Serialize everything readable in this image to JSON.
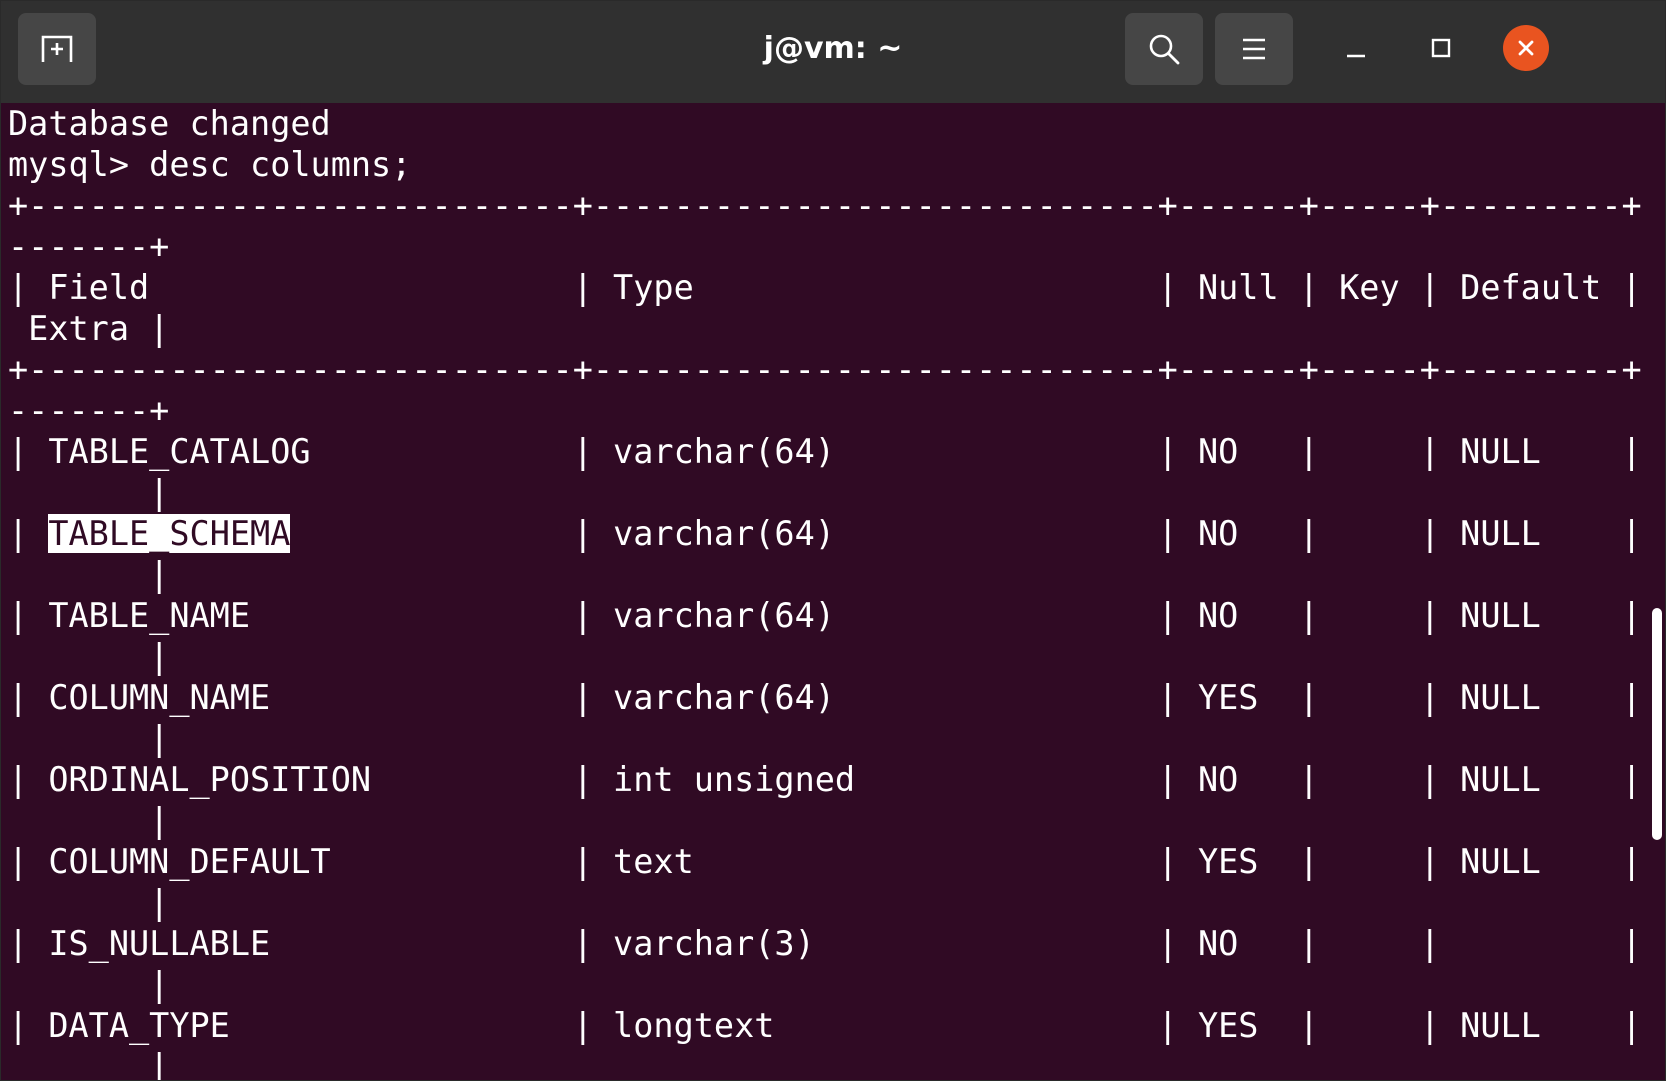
{
  "window": {
    "title": "j@vm: ~"
  },
  "titlebar": {
    "new_tab_icon": "new-tab-icon",
    "search_icon": "search-icon",
    "menu_icon": "hamburger-menu-icon",
    "minimize_icon": "minimize-icon",
    "maximize_icon": "maximize-icon",
    "close_icon": "close-icon"
  },
  "colors": {
    "titlebar_bg": "#303030",
    "terminal_bg": "#300a24",
    "close_button": "#e95420",
    "text": "#ffffff"
  },
  "terminal": {
    "lines": [
      "Database changed",
      "mysql> desc columns;",
      "+---------------------------+----------------------------+------+-----+---------+",
      "-------+",
      "| Field                     | Type                       | Null | Key | Default |",
      " Extra |",
      "+---------------------------+----------------------------+------+-----+---------+",
      "-------+",
      "| TABLE_CATALOG             | varchar(64)                | NO   |     | NULL    |",
      "       |",
      "| ",
      "       |",
      "| TABLE_NAME                | varchar(64)                | NO   |     | NULL    |",
      "       |",
      "| COLUMN_NAME               | varchar(64)                | YES  |     | NULL    |",
      "       |",
      "| ORDINAL_POSITION          | int unsigned               | NO   |     | NULL    |",
      "       |",
      "| COLUMN_DEFAULT            | text                       | YES  |     | NULL    |",
      "       |",
      "| IS_NULLABLE               | varchar(3)                 | NO   |     |         |",
      "       |",
      "| DATA_TYPE                 | longtext                   | YES  |     | NULL    |",
      "       |"
    ],
    "highlighted_field": "TABLE_SCHEMA",
    "highlighted_rest": "              | varchar(64)                | NO   |     | NULL    |"
  }
}
